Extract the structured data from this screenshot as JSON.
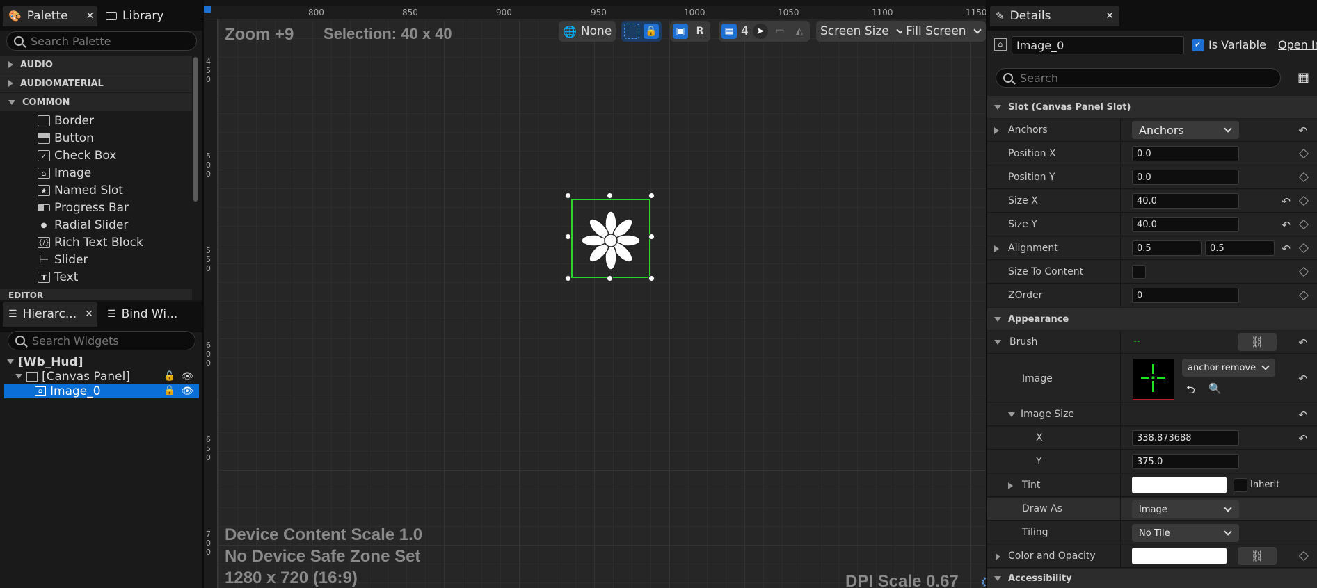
{
  "palette": {
    "tab_label": "Palette",
    "library_tab_label": "Library",
    "search_placeholder": "Search Palette",
    "categories": [
      "AUDIO",
      "AUDIOMATERIAL",
      "COMMON",
      "EDITOR"
    ],
    "items": [
      {
        "label": "Border",
        "icon": "border-icon"
      },
      {
        "label": "Button",
        "icon": "button-icon"
      },
      {
        "label": "Check Box",
        "icon": "checkbox-icon"
      },
      {
        "label": "Image",
        "icon": "image-icon"
      },
      {
        "label": "Named Slot",
        "icon": "named-slot-icon"
      },
      {
        "label": "Progress Bar",
        "icon": "progress-bar-icon"
      },
      {
        "label": "Radial Slider",
        "icon": "radial-slider-icon"
      },
      {
        "label": "Rich Text Block",
        "icon": "rich-text-icon"
      },
      {
        "label": "Slider",
        "icon": "slider-icon"
      },
      {
        "label": "Text",
        "icon": "text-icon"
      }
    ]
  },
  "hierarchy": {
    "tab_label": "Hierarc...",
    "bind_tab_label": "Bind Wi...",
    "search_placeholder": "Search Widgets",
    "nodes": [
      {
        "label": "[Wb_Hud]"
      },
      {
        "label": "[Canvas Panel]"
      },
      {
        "label": "Image_0"
      }
    ]
  },
  "viewport": {
    "zoom": "Zoom +9",
    "selection": "Selection: 40 x 40",
    "ruler_top": [
      "800",
      "850",
      "900",
      "950",
      "1000",
      "1050",
      "1100",
      "1150"
    ],
    "ruler_left": [
      "450",
      "500",
      "550",
      "600",
      "650",
      "700"
    ],
    "toolbar": {
      "none_label": "None",
      "r_label": "R",
      "grid_value": "4",
      "screen_size": "Screen Size",
      "fill_screen": "Fill Screen"
    },
    "device_scale": "Device Content Scale 1.0",
    "safe_zone": "No Device Safe Zone Set",
    "resolution": "1280 x 720 (16:9)",
    "dpi_scale": "DPI Scale 0.67"
  },
  "details": {
    "tab_label": "Details",
    "name_value": "Image_0",
    "is_variable_label": "Is Variable",
    "open_label": "Open In",
    "search_placeholder": "Search",
    "slot_section": "Slot (Canvas Panel Slot)",
    "anchors_label": "Anchors",
    "anchors_value": "Anchors",
    "position_x_label": "Position X",
    "position_x_value": "0.0",
    "position_y_label": "Position Y",
    "position_y_value": "0.0",
    "size_x_label": "Size X",
    "size_x_value": "40.0",
    "size_y_label": "Size Y",
    "size_y_value": "40.0",
    "alignment_label": "Alignment",
    "alignment_x": "0.5",
    "alignment_y": "0.5",
    "size_to_content_label": "Size To Content",
    "zorder_label": "ZOrder",
    "zorder_value": "0",
    "appearance_section": "Appearance",
    "brush_label": "Brush",
    "brush_value": "--",
    "image_label": "Image",
    "image_asset": "anchor-remove",
    "image_size_label": "Image Size",
    "image_size_x_label": "X",
    "image_size_x_value": "338.873688",
    "image_size_y_label": "Y",
    "image_size_y_value": "375.0",
    "tint_label": "Tint",
    "inherit_label": "Inherit",
    "draw_as_label": "Draw As",
    "draw_as_value": "Image",
    "tiling_label": "Tiling",
    "tiling_value": "No Tile",
    "color_opacity_label": "Color and Opacity",
    "accessibility_section": "Accessibility"
  },
  "colors": {
    "accent_blue": "#0a6fd6",
    "selection_green": "#2ad42a",
    "brush_preview_green": "#22e022"
  }
}
